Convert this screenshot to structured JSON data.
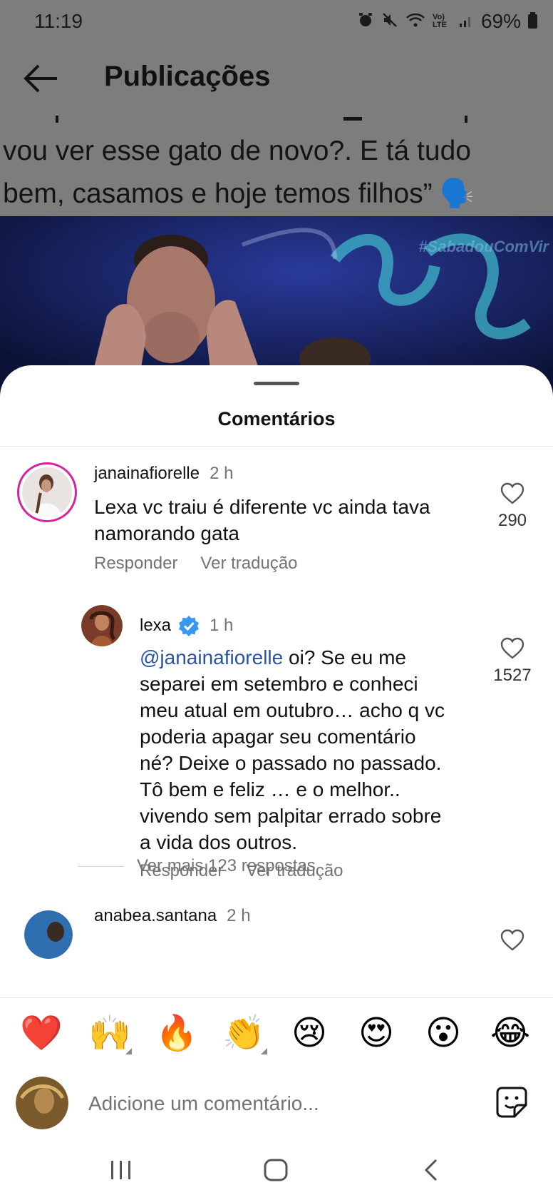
{
  "status_bar": {
    "time": "11:19",
    "network_label": "Vo) LTE",
    "battery": "69%",
    "icons": [
      "alarm-icon",
      "mute-icon",
      "wifi-icon",
      "volte-icon",
      "signal-icon",
      "battery-icon"
    ]
  },
  "header": {
    "title": "Publicações",
    "back_icon": "arrow-left-icon"
  },
  "post": {
    "caption_line_1": "vou ver esse gato de novo?. E tá tudo",
    "caption_line_2": "bem, casamos e hoje temos filhos” 🗣️",
    "hashtag": "#SabadouComVir"
  },
  "sheet": {
    "title": "Comentários"
  },
  "comments": [
    {
      "username": "janainafiorelle",
      "time": "2 h",
      "text_line_1": "Lexa vc traiu é diferente vc ainda tava",
      "text_line_2": "namorando gata",
      "likes": "290",
      "reply_label": "Responder",
      "translate_label": "Ver tradução"
    },
    {
      "username": "lexa",
      "time": "1 h",
      "mention": "@janainafiorelle",
      "text_lines": [
        " oi? Se eu me",
        "separei em setembro e conheci",
        "meu atual em outubro… acho q vc",
        "poderia apagar seu comentário",
        "né? Deixe o passado no passado.",
        "Tô bem e feliz … e o melhor..",
        "vivendo sem palpitar errado sobre",
        "a vida dos outros."
      ],
      "likes": "1527",
      "reply_label": "Responder",
      "translate_label": "Ver tradução"
    },
    {
      "username": "anabea.santana",
      "time": "2 h"
    }
  ],
  "more_replies_label": "Ver mais 123 respostas",
  "emoji_bar": [
    "❤️",
    "🙌",
    "🔥",
    "👏",
    "😢",
    "😍",
    "😮",
    "😂"
  ],
  "input": {
    "placeholder": "Adicione um comentário..."
  },
  "colors": {
    "mention": "#2a53a6",
    "verified": "#3897f0",
    "secondary_text": "#737373",
    "overlay": "#7d7d7d"
  }
}
